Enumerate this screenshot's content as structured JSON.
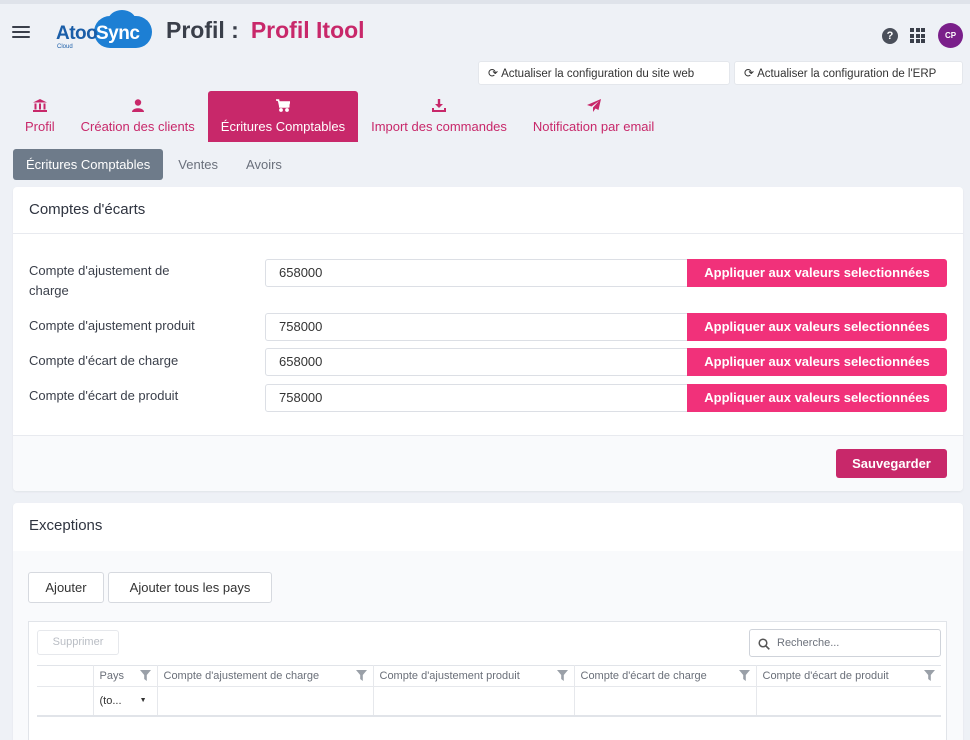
{
  "header": {
    "logo_left": "Atoo",
    "logo_right": "Sync",
    "logo_small": "Cloud",
    "title_label": "Profil :",
    "profile_name": "Profil Itool",
    "help_icon": "question-circle-icon",
    "apps_icon": "grid-apps-icon",
    "avatar_initials": "CP"
  },
  "actions": {
    "refresh_site": "Actualiser la configuration du site web",
    "refresh_erp": "Actualiser la configuration de l'ERP"
  },
  "main_tabs": [
    {
      "label": "Profil",
      "icon": "bank-icon",
      "active": false
    },
    {
      "label": "Création des clients",
      "icon": "user-icon",
      "active": false
    },
    {
      "label": "Écritures Comptables",
      "icon": "cart-icon",
      "active": true
    },
    {
      "label": "Import des commandes",
      "icon": "download-icon",
      "active": false
    },
    {
      "label": "Notification par email",
      "icon": "paper-plane-icon",
      "active": false
    }
  ],
  "sub_tabs": [
    {
      "label": "Écritures Comptables",
      "active": true
    },
    {
      "label": "Ventes",
      "active": false
    },
    {
      "label": "Avoirs",
      "active": false
    }
  ],
  "ecarts": {
    "title": "Comptes d'écarts",
    "rows": [
      {
        "label": "Compte d'ajustement de charge",
        "value": "658000",
        "button": "Appliquer aux valeurs selectionnées"
      },
      {
        "label": "Compte d'ajustement produit",
        "value": "758000",
        "button": "Appliquer aux valeurs selectionnées"
      },
      {
        "label": "Compte d'écart de charge",
        "value": "658000",
        "button": "Appliquer aux valeurs selectionnées"
      },
      {
        "label": "Compte d'écart de produit",
        "value": "758000",
        "button": "Appliquer aux valeurs selectionnées"
      }
    ],
    "save_label": "Sauvegarder"
  },
  "exceptions": {
    "title": "Exceptions",
    "add_label": "Ajouter",
    "add_all_label": "Ajouter tous les pays",
    "delete_label": "Supprimer",
    "search_placeholder": "Recherche...",
    "columns": [
      "Pays",
      "Compte d'ajustement de charge",
      "Compte d'ajustement produit",
      "Compte d'écart de charge",
      "Compte d'écart de produit"
    ],
    "pays_filter_value": "(to..."
  },
  "colors": {
    "brand": "#c8286a",
    "accent_button": "#f1317a",
    "subtab_active": "#6e7b8a",
    "background": "#eef1f6"
  }
}
